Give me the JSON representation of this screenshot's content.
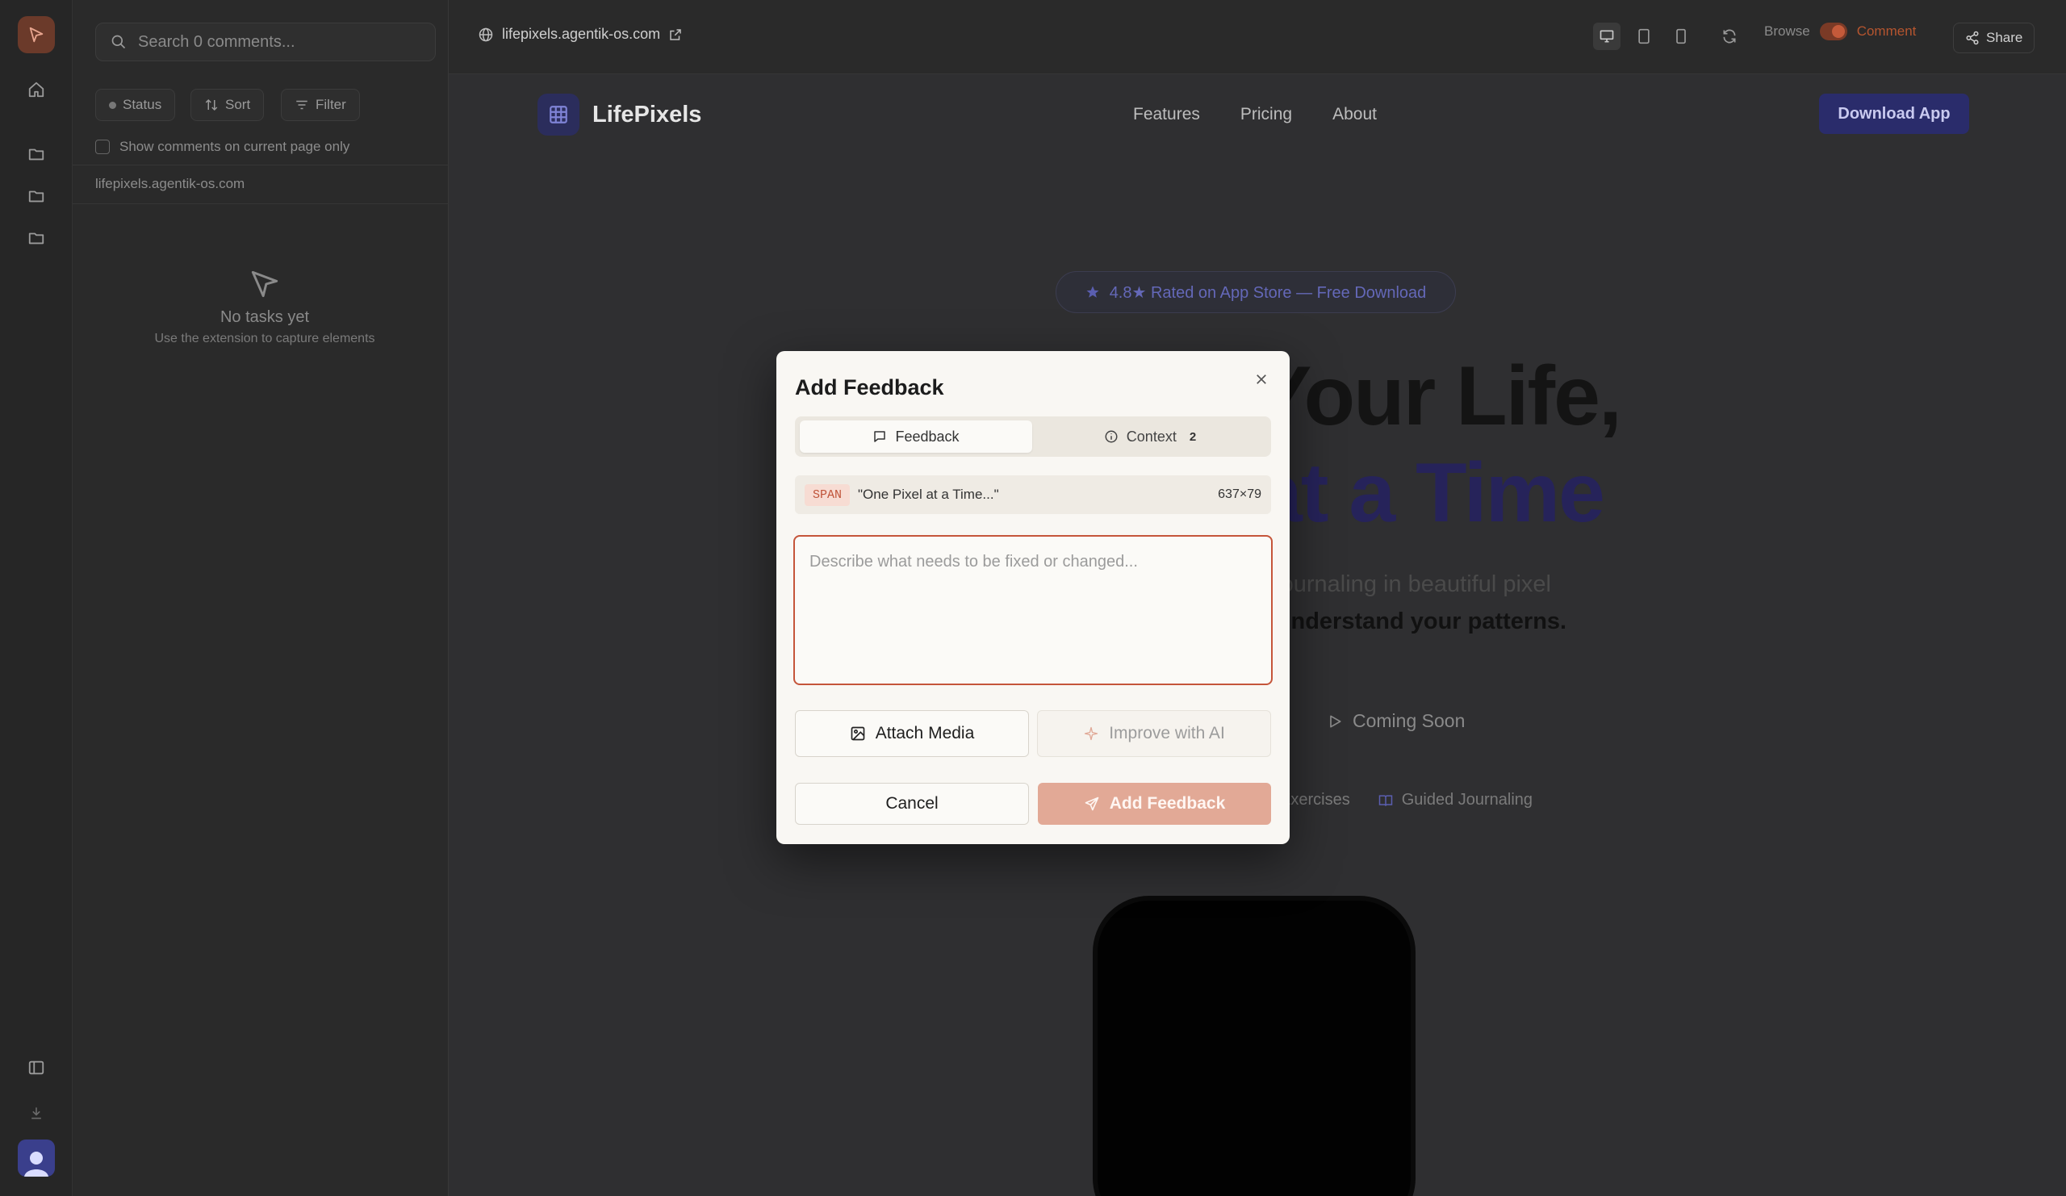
{
  "panel": {
    "search_placeholder": "Search 0 comments...",
    "status_label": "Status",
    "sort_label": "Sort",
    "filter_label": "Filter",
    "show_current_page_label": "Show comments on current page only",
    "domain": "lifepixels.agentik-os.com",
    "empty_title": "No tasks yet",
    "empty_subtitle": "Use the extension to capture elements"
  },
  "topbar": {
    "url": "lifepixels.agentik-os.com",
    "browse_label": "Browse",
    "comment_label": "Comment",
    "share_label": "Share"
  },
  "site": {
    "brand": "LifePixels",
    "nav": [
      "Features",
      "Pricing",
      "About"
    ],
    "download_label": "Download App",
    "badge": "4.8★ Rated on App Store — Free Download",
    "headline_1": "Your Life,",
    "headline_2": "at a Time",
    "sub_1": "d journaling in beautiful pixel",
    "sub_2": "u understand your patterns.",
    "coming_soon": "Coming Soon",
    "feature_1": "Exercises",
    "feature_2": "Guided Journaling"
  },
  "modal": {
    "title": "Add Feedback",
    "tab_feedback": "Feedback",
    "tab_context": "Context",
    "context_count": "2",
    "element_tag": "SPAN",
    "element_text": "\"One Pixel at a Time...\"",
    "element_size": "637×79",
    "textarea_placeholder": "Describe what needs to be fixed or changed...",
    "attach_label": "Attach Media",
    "improve_label": "Improve with AI",
    "cancel_label": "Cancel",
    "add_label": "Add Feedback"
  },
  "colors": {
    "accent": "#c5553a",
    "add_button": "#e2a996",
    "brand_indigo": "#26235a"
  }
}
